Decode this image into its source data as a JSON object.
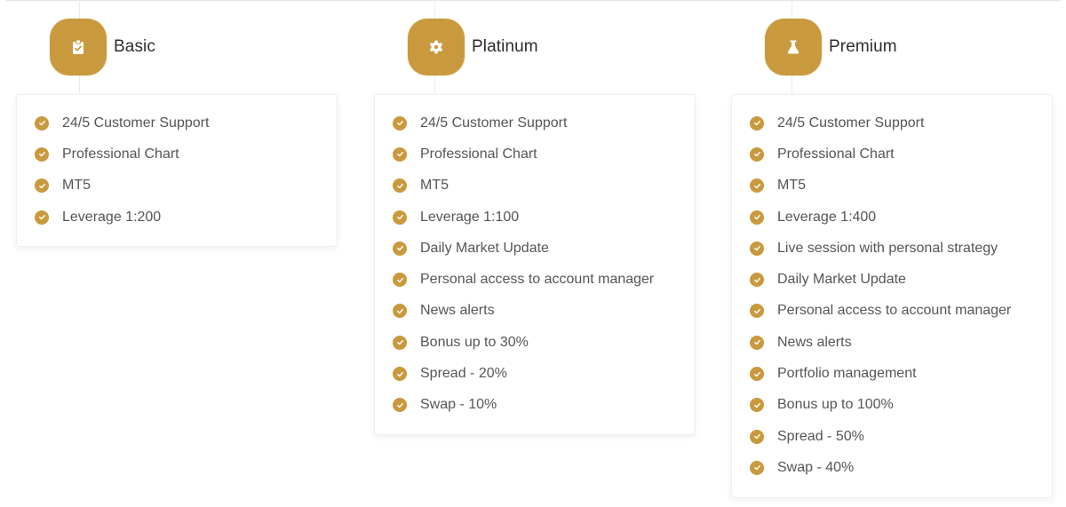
{
  "theme": {
    "accent": "#c9993d",
    "text": "#555555",
    "title": "#2d2d2d"
  },
  "plans": [
    {
      "name": "Basic",
      "icon": "clipboard-check-icon",
      "features": [
        "24/5 Customer Support",
        "Professional Chart",
        "MT5",
        "Leverage 1:200"
      ]
    },
    {
      "name": "Platinum",
      "icon": "gear-icon",
      "features": [
        "24/5 Customer Support",
        "Professional Chart",
        "MT5",
        "Leverage 1:100",
        "Daily Market Update",
        "Personal access to account manager",
        "News alerts",
        "Bonus up to 30%",
        "Spread - 20%",
        "Swap - 10%"
      ]
    },
    {
      "name": "Premium",
      "icon": "flask-icon",
      "features": [
        "24/5 Customer Support",
        "Professional Chart",
        "MT5",
        "Leverage 1:400",
        "Live session with personal strategy",
        "Daily Market Update",
        "Personal access to account manager",
        "News alerts",
        "Portfolio management",
        "Bonus up to 100%",
        "Spread - 50%",
        "Swap - 40%"
      ]
    }
  ]
}
